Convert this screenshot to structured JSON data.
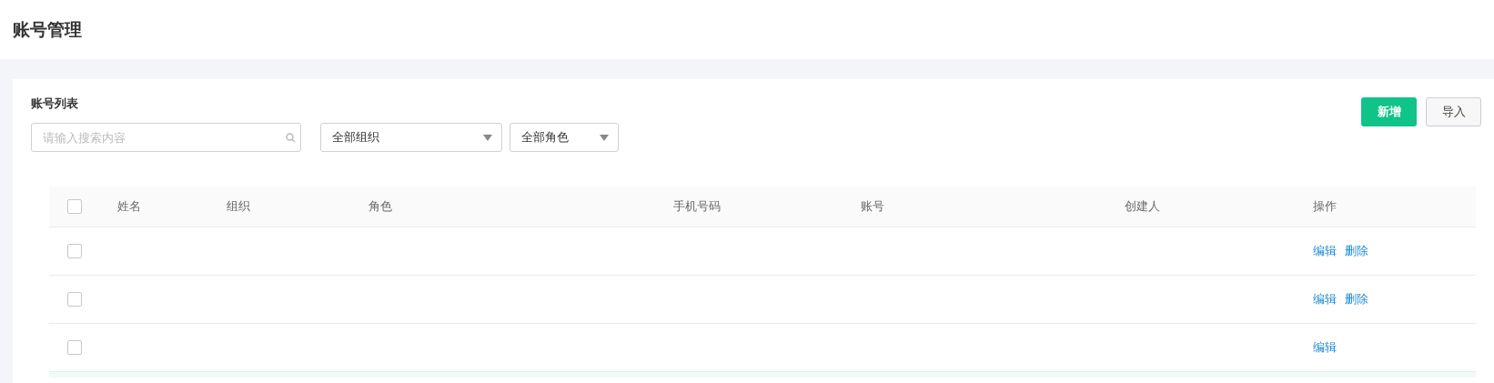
{
  "page_title": "账号管理",
  "panel": {
    "title": "账号列表",
    "search": {
      "placeholder": "请输入搜索内容"
    },
    "filters": [
      {
        "value": "全部组织"
      },
      {
        "value": "全部角色"
      }
    ],
    "buttons": [
      {
        "label": "新增",
        "kind": "primary"
      },
      {
        "label": "导入",
        "kind": "default"
      }
    ]
  },
  "table": {
    "select_all": {
      "checked": false
    },
    "columns": [
      "姓名",
      "组织",
      "角色",
      "手机号码",
      "账号",
      "创建人",
      "操作"
    ],
    "rows": [
      {
        "checked": false,
        "actions": [
          "编辑",
          "删除"
        ]
      },
      {
        "checked": false,
        "actions": [
          "编辑",
          "删除"
        ]
      },
      {
        "checked": false,
        "actions": [
          "编辑"
        ]
      }
    ]
  }
}
